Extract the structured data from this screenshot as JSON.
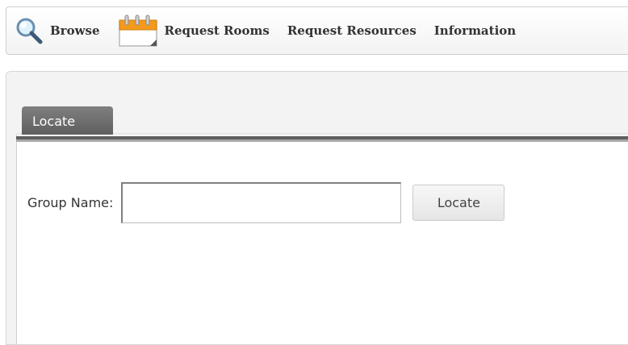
{
  "nav": {
    "items": [
      {
        "label": "Browse",
        "icon": "magnifier-icon"
      },
      {
        "label": "Request Rooms",
        "icon": "calendar-icon"
      },
      {
        "label": "Request Resources"
      },
      {
        "label": "Information"
      }
    ]
  },
  "tabs": [
    {
      "label": "Locate",
      "active": true
    }
  ],
  "form": {
    "group_name_label": "Group Name:",
    "group_name_value": "",
    "locate_button_label": "Locate"
  },
  "colors": {
    "tab_active": "#6e6e6e",
    "tab_text": "#ffffff",
    "calendar_accent": "#f39a1c"
  }
}
